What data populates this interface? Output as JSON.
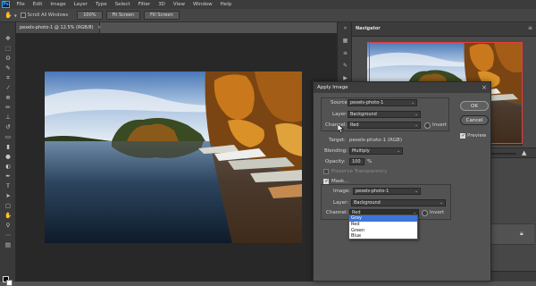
{
  "menubar": {
    "logo": "Ps",
    "items": [
      "File",
      "Edit",
      "Image",
      "Layer",
      "Type",
      "Select",
      "Filter",
      "3D",
      "View",
      "Window",
      "Help"
    ]
  },
  "options": {
    "scroll_all_windows": "Scroll All Windows",
    "zoom_100": "100%",
    "fit_screen": "Fit Screen",
    "fill_screen": "Fill Screen"
  },
  "document": {
    "tab_title": "pexels-photo-1 @ 12.5% (RGB/8)",
    "close": "×"
  },
  "navigator": {
    "tab": "Navigator"
  },
  "dialog": {
    "title": "Apply Image",
    "close": "×",
    "source_label": "Source:",
    "source_value": "pexels-photo-1",
    "layer_label": "Layer:",
    "layer_value": "Background",
    "channel_label": "Channel:",
    "channel_value": "Red",
    "invert_label": "Invert",
    "target_label": "Target:",
    "target_value": "pexels-photo-1 (RGB)",
    "blending_label": "Blending:",
    "blending_value": "Multiply",
    "opacity_label": "Opacity:",
    "opacity_value": "100",
    "opacity_unit": "%",
    "preserve_transparency": "Preserve Transparency",
    "mask_label": "Mask...",
    "mask_image_label": "Image:",
    "mask_image_value": "pexels-photo-1",
    "mask_layer_label": "Layer:",
    "mask_layer_value": "Background",
    "mask_channel_label": "Channel:",
    "mask_channel_value": "Red",
    "mask_invert_label": "Invert",
    "ok": "OK",
    "cancel": "Cancel",
    "preview": "Preview"
  },
  "channel_dropdown": {
    "options": [
      "Gray",
      "Red",
      "Green",
      "Blue"
    ],
    "highlighted": "Gray"
  },
  "colors": {
    "proxy_box": "#e83c3c",
    "highlight": "#3c74d8"
  }
}
